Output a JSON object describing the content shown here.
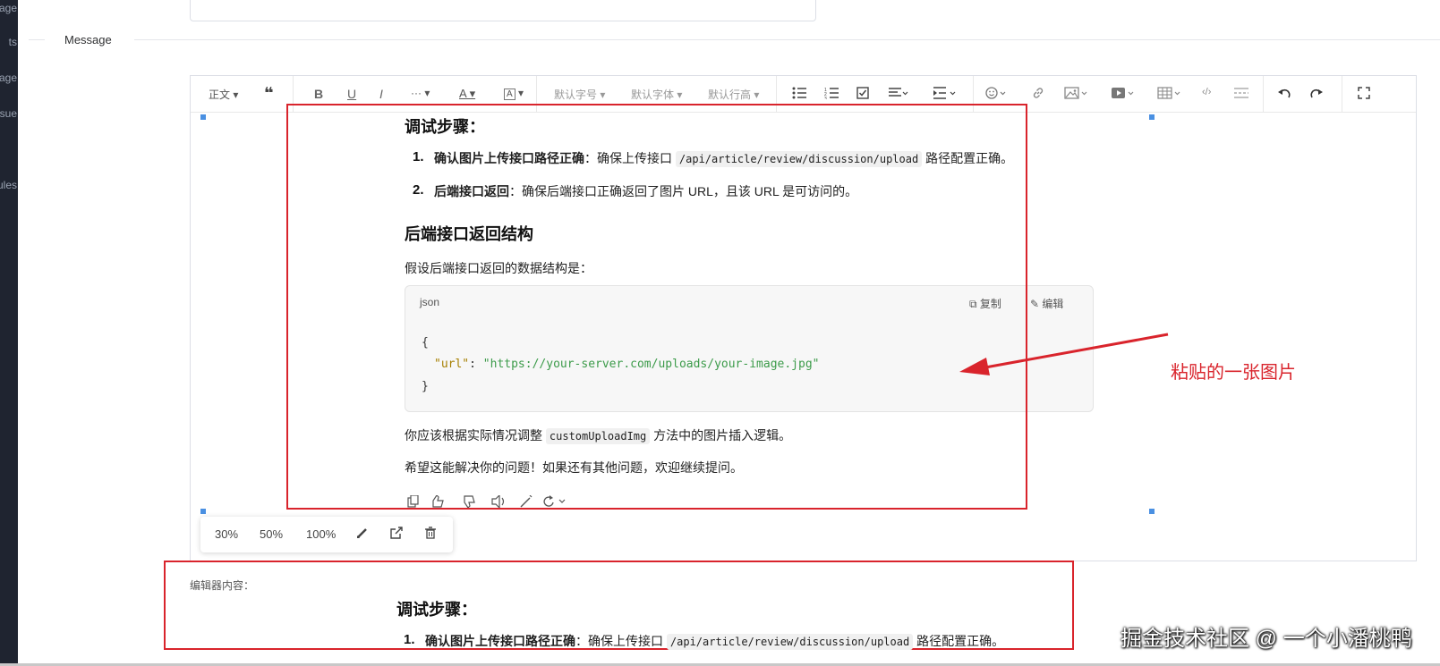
{
  "sidebar": {
    "items": [
      "age",
      "ts",
      "age",
      "sue",
      "ules"
    ]
  },
  "section": {
    "label": "Message"
  },
  "toolbar": {
    "paragraph": "正文",
    "font_size": "默认字号",
    "font_family": "默认字体",
    "line_height": "默认行高",
    "more": "···",
    "font_color": "A",
    "bg_color": "A",
    "bold": "B",
    "underline": "U",
    "italic": "I"
  },
  "pasted": {
    "heading1": "调试步骤：",
    "steps": [
      {
        "num": "1.",
        "bold": "确认图片上传接口路径正确",
        "pre": "：确保上传接口 ",
        "code": "/api/article/review/discussion/upload",
        "post": " 路径配置正确。"
      },
      {
        "num": "2.",
        "bold": "后端接口返回",
        "text": "：确保后端接口正确返回了图片 URL，且该 URL 是可访问的。"
      }
    ],
    "heading2": "后端接口返回结构",
    "intro": "假设后端接口返回的数据结构是：",
    "code_block": {
      "lang": "json",
      "copy": "复制",
      "edit": "编辑",
      "open": "{",
      "key": "\"url\"",
      "colon": ": ",
      "value": "\"https://your-server.com/uploads/your-image.jpg\"",
      "close": "}"
    },
    "adjust_pre": "你应该根据实际情况调整 ",
    "adjust_code": "customUploadImg",
    "adjust_post": " 方法中的图片插入逻辑。",
    "hope": "希望这能解决你的问题！如果还有其他问题，欢迎继续提问。"
  },
  "annotation": "粘贴的一张图片",
  "image_toolbar": {
    "w30": "30%",
    "w50": "50%",
    "w100": "100%"
  },
  "footer": {
    "label": "编辑器内容：",
    "heading": "调试步骤：",
    "step1_num": "1.",
    "step1_bold": "确认图片上传接口路径正确",
    "step1_pre": "：确保上传接口 ",
    "step1_code": "/api/article/review/discussion/upload",
    "step1_post": " 路径配置正确。"
  },
  "watermark": "掘金技术社区 @ 一个小潘桃鸭",
  "colors": {
    "annotation_red": "#d9242c",
    "handle_blue": "#4a90e2",
    "json_key": "#a67f00",
    "json_string": "#3c9b4a"
  }
}
